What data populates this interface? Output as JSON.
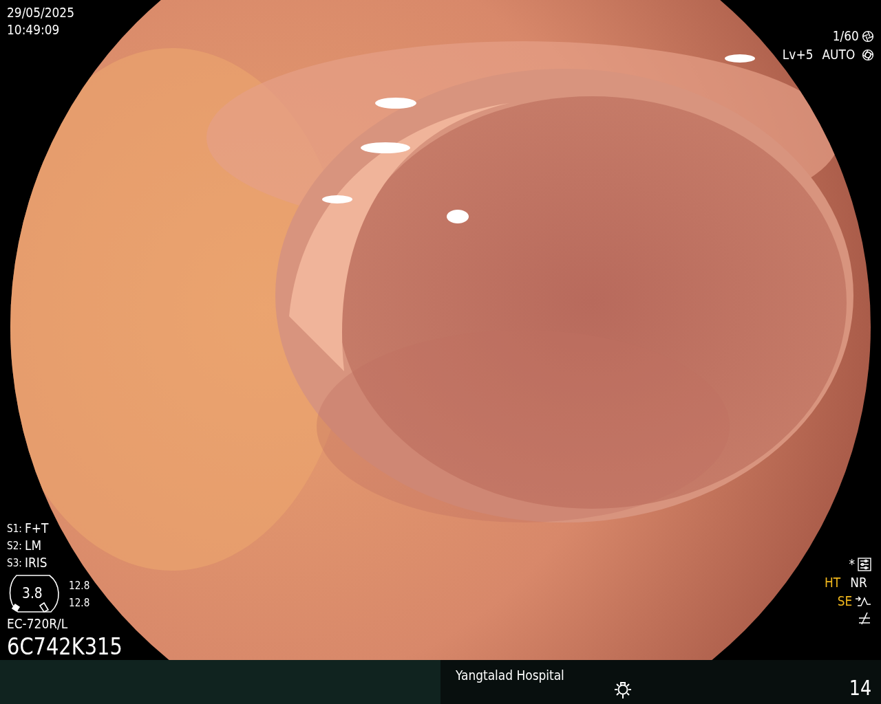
{
  "timestamp": {
    "date": "29/05/2025",
    "time": "10:49:09"
  },
  "exposure": {
    "shutter": "1/60",
    "level": "Lv+5",
    "mode": "AUTO"
  },
  "switches": [
    {
      "label": "S1:",
      "value": "F+T"
    },
    {
      "label": "S2:",
      "value": "LM"
    },
    {
      "label": "S3:",
      "value": "IRIS"
    }
  ],
  "zoom_gauge": {
    "value": "3.8",
    "readings": [
      "12.8",
      "12.8"
    ]
  },
  "scope": {
    "model": "EC-720R/L",
    "serial": "6C742K315"
  },
  "marker": "*",
  "enhancement": [
    {
      "label": "HT",
      "on": true
    },
    {
      "label": "NR",
      "on": false
    }
  ],
  "structure": {
    "label": "SE",
    "on": true
  },
  "footer": {
    "hospital": "Yangtalad Hospital",
    "count": "14"
  }
}
